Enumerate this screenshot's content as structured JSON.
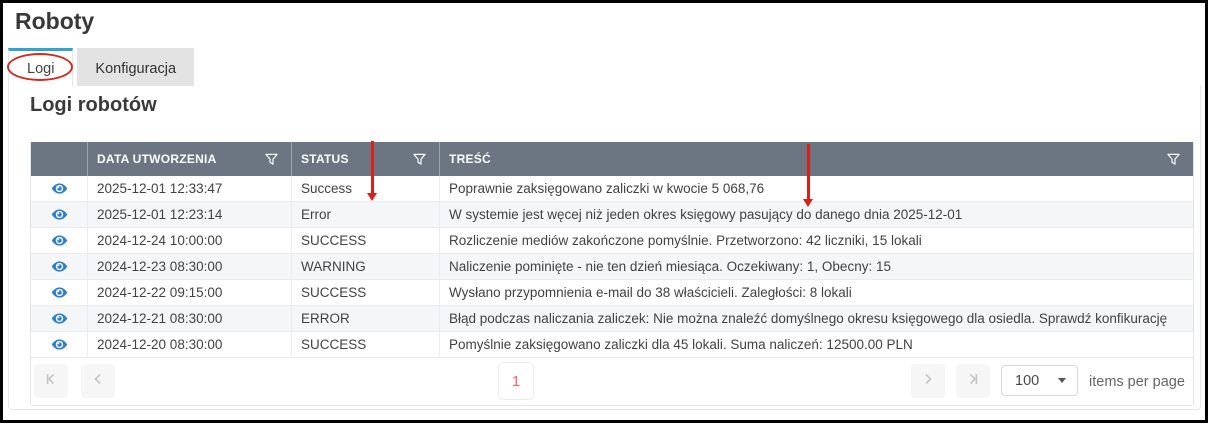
{
  "page": {
    "title": "Roboty"
  },
  "tabs": {
    "logi": "Logi",
    "konfiguracja": "Konfiguracja",
    "active_tab": "Logi"
  },
  "section": {
    "heading": "Logi robotów"
  },
  "grid": {
    "columns": {
      "created": "DATA UTWORZENIA",
      "status": "STATUS",
      "content": "TREŚĆ"
    },
    "rows": [
      {
        "created": "2025-12-01 12:33:47",
        "status": "Success",
        "content": "Poprawnie zaksięgowano zaliczki w kwocie 5 068,76"
      },
      {
        "created": "2025-12-01 12:23:14",
        "status": "Error",
        "content": "W systemie jest węcej niż jeden okres księgowy pasujący do danego dnia 2025-12-01"
      },
      {
        "created": "2024-12-24 10:00:00",
        "status": "SUCCESS",
        "content": "Rozliczenie mediów zakończone pomyślnie. Przetworzono: 42 liczniki, 15 lokali"
      },
      {
        "created": "2024-12-23 08:30:00",
        "status": "WARNING",
        "content": "Naliczenie pominięte - nie ten dzień miesiąca. Oczekiwany: 1, Obecny: 15"
      },
      {
        "created": "2024-12-22 09:15:00",
        "status": "SUCCESS",
        "content": "Wysłano przypomnienia e-mail do 38 właścicieli. Zaległości: 8 lokali"
      },
      {
        "created": "2024-12-21 08:30:00",
        "status": "ERROR",
        "content": "Błąd podczas naliczania zaliczek: Nie można znaleźć domyślnego okresu księgowego dla osiedla. Sprawdź konfikurację"
      },
      {
        "created": "2024-12-20 08:30:00",
        "status": "SUCCESS",
        "content": "Pomyślnie zaksięgowano zaliczki dla 45 lokali. Suma naliczeń: 12500.00 PLN"
      }
    ]
  },
  "pager": {
    "current_page": "1",
    "page_size": "100",
    "items_per_page_label": "items per page"
  },
  "colors": {
    "header_bg": "#6b7682",
    "active_tab_accent": "#2fa3d4",
    "eye_icon_blue": "#2b7fd0",
    "page_number_accent": "#ff6358",
    "annotation_red": "#dd1f17",
    "row_alt_bg": "#f4f6f8"
  },
  "annotations": {
    "ellipse_marks": "Logi",
    "arrow1_marks": "STATUS",
    "arrow2_marks": "TREŚĆ"
  }
}
